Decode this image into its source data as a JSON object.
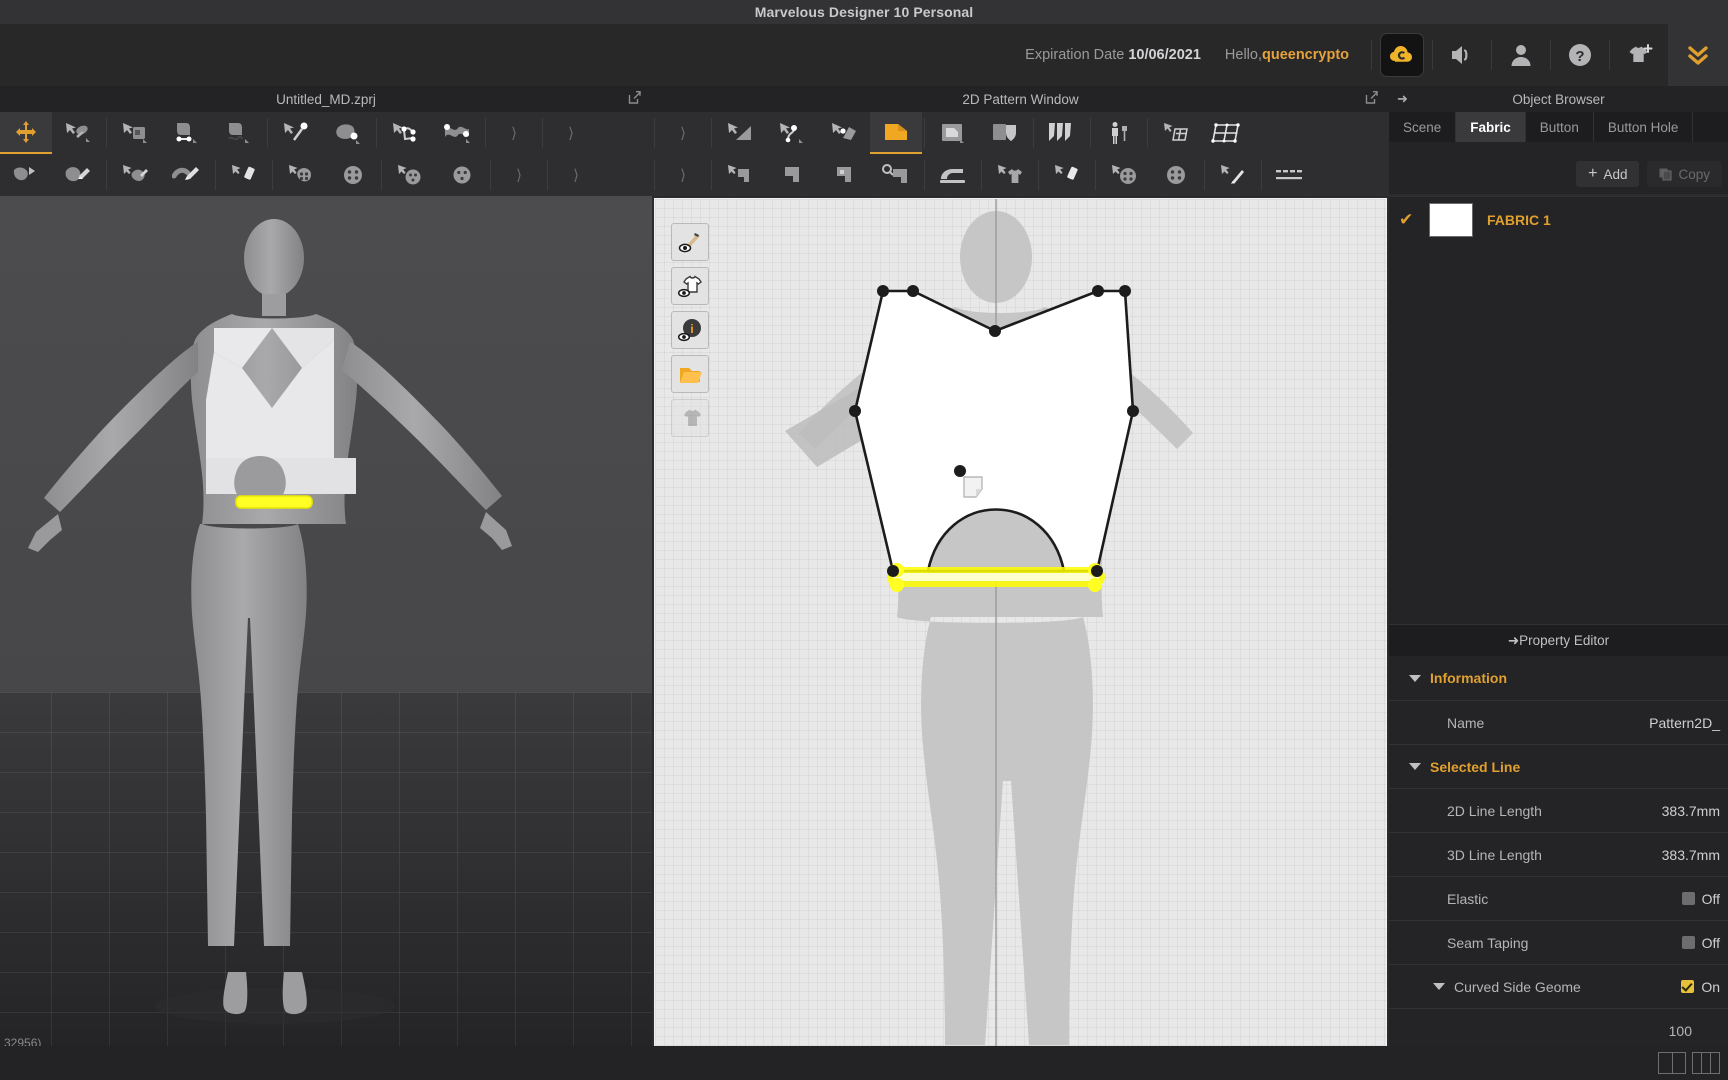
{
  "window": {
    "title": "Marvelous Designer 10 Personal"
  },
  "account": {
    "expiration_label": "Expiration Date",
    "expiration_date": "10/06/2021",
    "hello_label": "Hello,",
    "username": "queencrypto",
    "icons": [
      "cloud-icon",
      "speaker-icon",
      "person-icon",
      "help-icon",
      "garment-add-icon",
      "chevron-double-down-icon"
    ]
  },
  "viewport3d": {
    "title": "Untitled_MD.zprj",
    "status": "32956)"
  },
  "viewport2d": {
    "title": "2D Pattern Window",
    "tools": [
      "toggle-stitch-visibility",
      "toggle-garment-visibility",
      "toggle-info-visibility",
      "toggle-pattern-visibility",
      "toggle-avatar-visibility"
    ]
  },
  "object_browser": {
    "title": "Object Browser",
    "arrow": "➜",
    "tabs": [
      {
        "label": "Scene",
        "selected": false
      },
      {
        "label": "Fabric",
        "selected": true
      },
      {
        "label": "Button",
        "selected": false
      },
      {
        "label": "Button Hole",
        "selected": false
      }
    ],
    "add_label": "Add",
    "copy_label": "Copy",
    "items": [
      {
        "name": "FABRIC 1",
        "checked": true,
        "swatch": "#ffffff"
      }
    ]
  },
  "property_editor": {
    "title": "Property Editor",
    "arrow": "➜",
    "sections": [
      {
        "name": "Information",
        "rows": [
          {
            "label": "Name",
            "value": "Pattern2D_"
          }
        ]
      },
      {
        "name": "Selected Line",
        "rows": [
          {
            "label": "2D Line Length",
            "value": "383.7mm"
          },
          {
            "label": "3D Line Length",
            "value": "383.7mm"
          },
          {
            "label": "Elastic",
            "value": "Off",
            "checkbox": "off"
          },
          {
            "label": "Seam Taping",
            "value": "Off",
            "checkbox": "off"
          }
        ]
      }
    ],
    "curved_side": {
      "label": "Curved Side Geome",
      "value": "On",
      "checkbox": "on",
      "sub_value": "100"
    }
  },
  "colors": {
    "accent": "#e0a030",
    "highlight_yellow": "#ffff1a",
    "panel_bg": "#242426",
    "toolbar_bg": "#2e2e30",
    "titlebar_bg": "#333335"
  },
  "toolbar_3d_row1": [
    "transform-tool",
    "select-mesh-tool",
    "sep",
    "pin-tool",
    "segment-pin-tool",
    "curve-pin-tool",
    "sep",
    "tack-tool",
    "tack-on-avatar-tool",
    "sep",
    "seam-line-tool",
    "free-seam-line-tool",
    "sep",
    "more-chevron",
    "sep",
    "more-chevron"
  ],
  "toolbar_3d_row2": [
    "fold-arrangement-tool",
    "pen-garment-tool",
    "sep",
    "flatten-tool",
    "edit-brush-tool",
    "sep",
    "zipper-tool",
    "sep",
    "button-tool",
    "buttonhole-tool",
    "sep",
    "snap-tool",
    "snap-edit-tool",
    "sep",
    "more-chevron",
    "sep",
    "more-chevron"
  ],
  "toolbar_2d_row1": [
    "more-chevron",
    "sep",
    "edit-pattern-tool",
    "edit-curve-point-tool",
    "sep",
    "transform-pattern-tool",
    "polygon-tool",
    "sep",
    "rectangle-tool",
    "pocket-tool",
    "sep",
    "pleat-tool",
    "sep",
    "avatar-measure-tool",
    "sep",
    "grid-tool",
    "grid-edit-tool"
  ],
  "toolbar_2d_row2": [
    "more-chevron",
    "sep",
    "fabric-cut-tool",
    "dart-tool",
    "notch-tool",
    "trace-tool",
    "sep",
    "iron-tool",
    "sep",
    "garment-tool",
    "sep",
    "zipper-2d-tool",
    "sep",
    "button-2d-tool",
    "buttonhole-2d-tool",
    "sep",
    "pen-tool",
    "sep",
    "dotted-line-tool"
  ],
  "bottom_bar": {
    "buttons": [
      "layout-2-pane",
      "layout-4-pane"
    ]
  }
}
